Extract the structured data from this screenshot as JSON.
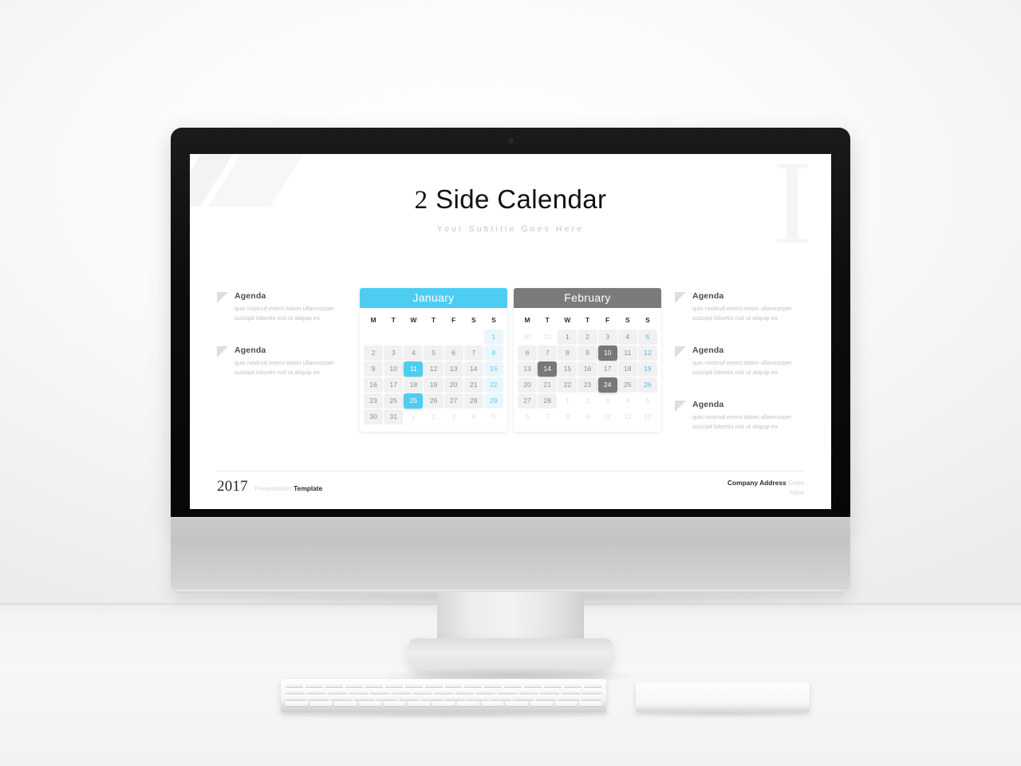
{
  "slide": {
    "title_numeral": "2",
    "title_text": " Side Calendar",
    "subtitle": "Your Subtitle Goes Here",
    "watermark": "I"
  },
  "agenda_left": [
    {
      "title": "Agenda",
      "body": "quis nostrud exerci tation ullamcorper suscipit lobortis nisl ut aliquip ex"
    },
    {
      "title": "Agenda",
      "body": "quis nostrud exerci tation ullamcorper suscipit lobortis nisl ut aliquip ex"
    }
  ],
  "agenda_right": [
    {
      "title": "Agenda",
      "body": "quis nostrud exerci tation ullamcorper suscipit lobortis nisl ut aliquip ex"
    },
    {
      "title": "Agenda",
      "body": "quis nostrud exerci tation ullamcorper suscipit lobortis nisl ut aliquip ex"
    },
    {
      "title": "Agenda",
      "body": "quis nostrud exerci tation ullamcorper suscipit lobortis nisl ut aliquip ex"
    }
  ],
  "weekdays": [
    "M",
    "T",
    "W",
    "T",
    "F",
    "S",
    "S"
  ],
  "calendars": [
    {
      "name": "january",
      "month": "January",
      "accent": "#4ecdf2",
      "header_bg": "#4ecdf2",
      "highlight_bg": "#4ecdf2",
      "weeks": [
        [
          {
            "label": "",
            "type": "blank"
          },
          {
            "label": "",
            "type": "blank"
          },
          {
            "label": "",
            "type": "blank"
          },
          {
            "label": "",
            "type": "blank"
          },
          {
            "label": "",
            "type": "blank"
          },
          {
            "label": "",
            "type": "blank"
          },
          {
            "label": "1",
            "type": "sun"
          }
        ],
        [
          {
            "label": "2",
            "type": "day"
          },
          {
            "label": "3",
            "type": "day"
          },
          {
            "label": "4",
            "type": "day"
          },
          {
            "label": "5",
            "type": "day"
          },
          {
            "label": "6",
            "type": "day"
          },
          {
            "label": "7",
            "type": "day"
          },
          {
            "label": "8",
            "type": "sun"
          }
        ],
        [
          {
            "label": "9",
            "type": "day"
          },
          {
            "label": "10",
            "type": "day"
          },
          {
            "label": "11",
            "type": "hl"
          },
          {
            "label": "12",
            "type": "day"
          },
          {
            "label": "13",
            "type": "day"
          },
          {
            "label": "14",
            "type": "day"
          },
          {
            "label": "15",
            "type": "sun"
          }
        ],
        [
          {
            "label": "16",
            "type": "day"
          },
          {
            "label": "17",
            "type": "day"
          },
          {
            "label": "18",
            "type": "day"
          },
          {
            "label": "19",
            "type": "day"
          },
          {
            "label": "20",
            "type": "day"
          },
          {
            "label": "21",
            "type": "day"
          },
          {
            "label": "22",
            "type": "sun"
          }
        ],
        [
          {
            "label": "23",
            "type": "day"
          },
          {
            "label": "25",
            "type": "day"
          },
          {
            "label": "25",
            "type": "hl"
          },
          {
            "label": "26",
            "type": "day"
          },
          {
            "label": "27",
            "type": "day"
          },
          {
            "label": "28",
            "type": "day"
          },
          {
            "label": "29",
            "type": "sun"
          }
        ],
        [
          {
            "label": "30",
            "type": "day"
          },
          {
            "label": "31",
            "type": "day"
          },
          {
            "label": "1",
            "type": "out"
          },
          {
            "label": "2",
            "type": "out"
          },
          {
            "label": "3",
            "type": "out"
          },
          {
            "label": "4",
            "type": "out"
          },
          {
            "label": "5",
            "type": "out"
          }
        ]
      ]
    },
    {
      "name": "february",
      "month": "February",
      "accent": "#7b7b7b",
      "header_bg": "#7b7b7b",
      "highlight_bg": "#76787a",
      "weeks": [
        [
          {
            "label": "30",
            "type": "out"
          },
          {
            "label": "31",
            "type": "out"
          },
          {
            "label": "1",
            "type": "day"
          },
          {
            "label": "2",
            "type": "day"
          },
          {
            "label": "3",
            "type": "day"
          },
          {
            "label": "4",
            "type": "day"
          },
          {
            "label": "5",
            "type": "sun-gray"
          }
        ],
        [
          {
            "label": "6",
            "type": "day"
          },
          {
            "label": "7",
            "type": "day"
          },
          {
            "label": "8",
            "type": "day"
          },
          {
            "label": "9",
            "type": "day"
          },
          {
            "label": "10",
            "type": "hl"
          },
          {
            "label": "11",
            "type": "day"
          },
          {
            "label": "12",
            "type": "sun-gray"
          }
        ],
        [
          {
            "label": "13",
            "type": "day"
          },
          {
            "label": "14",
            "type": "hl"
          },
          {
            "label": "15",
            "type": "day"
          },
          {
            "label": "16",
            "type": "day"
          },
          {
            "label": "17",
            "type": "day"
          },
          {
            "label": "18",
            "type": "day"
          },
          {
            "label": "19",
            "type": "sun-gray"
          }
        ],
        [
          {
            "label": "20",
            "type": "day"
          },
          {
            "label": "21",
            "type": "day"
          },
          {
            "label": "22",
            "type": "day"
          },
          {
            "label": "23",
            "type": "day"
          },
          {
            "label": "24",
            "type": "hl"
          },
          {
            "label": "25",
            "type": "day"
          },
          {
            "label": "26",
            "type": "sun-gray"
          }
        ],
        [
          {
            "label": "27",
            "type": "day"
          },
          {
            "label": "28",
            "type": "day"
          },
          {
            "label": "1",
            "type": "out"
          },
          {
            "label": "2",
            "type": "out"
          },
          {
            "label": "3",
            "type": "out"
          },
          {
            "label": "4",
            "type": "out"
          },
          {
            "label": "5",
            "type": "out"
          }
        ],
        [
          {
            "label": "6",
            "type": "out"
          },
          {
            "label": "7",
            "type": "out"
          },
          {
            "label": "8",
            "type": "out"
          },
          {
            "label": "9",
            "type": "out"
          },
          {
            "label": "10",
            "type": "out"
          },
          {
            "label": "11",
            "type": "out"
          },
          {
            "label": "12",
            "type": "out"
          }
        ]
      ]
    }
  ],
  "footer": {
    "year": "2017",
    "tagline_muted": "Presentation",
    "tagline_strong": "Template",
    "address_strong": "Company Address",
    "address_muted": "Goes Here"
  }
}
